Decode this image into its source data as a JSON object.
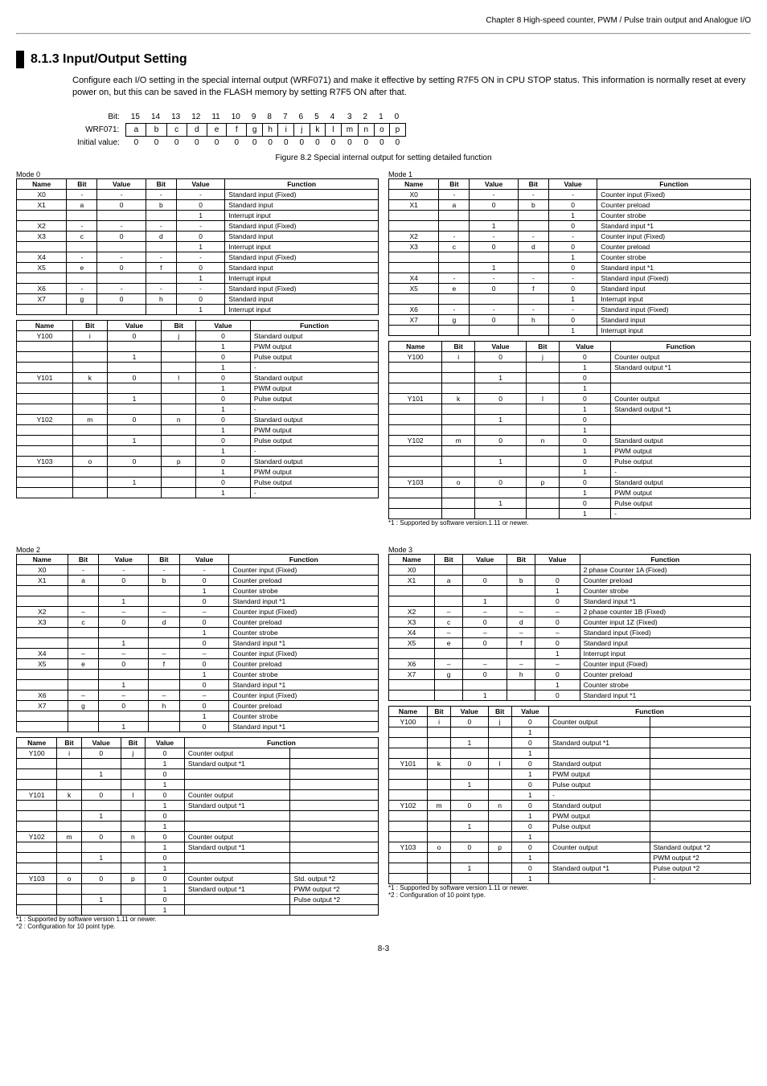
{
  "chapter": "Chapter 8  High-speed counter, PWM / Pulse train output and Analogue I/O",
  "section": "8.1.3    Input/Output Setting",
  "intro": "Configure each I/O setting in the special internal output (WRF071) and make it effective by setting R7F5 ON in CPU STOP status. This information is normally reset at every power on, but this can be saved in the FLASH memory by setting R7F5 ON after that.",
  "bit": {
    "label_bit": "Bit:",
    "label_wr": "WRF071:",
    "label_iv": "Initial value:",
    "cols": [
      "15",
      "14",
      "13",
      "12",
      "11",
      "10",
      "9",
      "8",
      "7",
      "6",
      "5",
      "4",
      "3",
      "2",
      "1",
      "0"
    ],
    "wr": [
      "a",
      "b",
      "c",
      "d",
      "e",
      "f",
      "g",
      "h",
      "i",
      "j",
      "k",
      "l",
      "m",
      "n",
      "o",
      "p"
    ],
    "iv": [
      "0",
      "0",
      "0",
      "0",
      "0",
      "0",
      "0",
      "0",
      "0",
      "0",
      "0",
      "0",
      "0",
      "0",
      "0",
      "0"
    ]
  },
  "caption": "Figure 8.2 Special internal output for setting detailed function",
  "heads": {
    "name": "Name",
    "bit": "Bit",
    "value": "Value",
    "bit2": "Bit",
    "value2": "Value",
    "fun": "Function"
  },
  "modes": {
    "m0": "Mode 0",
    "m1": "Mode 1",
    "m2": "Mode 2",
    "m3": "Mode 3"
  },
  "foot1": "*1 : Supported by software version.1.11 or newer.",
  "foot2_a": "*1 : Supported by software version 1.11 or newer.",
  "foot2_b": "*2 : Configuration for 10 point type.",
  "foot3_a": "*1 : Supported by software version 1.11 or newer.",
  "foot3_b": "*2 : Configuration of 10 point type.",
  "page": "8-3",
  "chart_data": [
    {
      "id": "m0a",
      "rows": [
        [
          "X0",
          "-",
          "-",
          "-",
          "-",
          "Standard input (Fixed)"
        ],
        [
          "X1",
          "a",
          "0",
          "b",
          "0",
          "Standard input"
        ],
        [
          "",
          "",
          "",
          "",
          "1",
          "Interrupt input"
        ],
        [
          "X2",
          "-",
          "-",
          "-",
          "-",
          "Standard input (Fixed)"
        ],
        [
          "X3",
          "c",
          "0",
          "d",
          "0",
          "Standard input"
        ],
        [
          "",
          "",
          "",
          "",
          "1",
          "Interrupt input"
        ],
        [
          "X4",
          "-",
          "-",
          "-",
          "-",
          "Standard input (Fixed)"
        ],
        [
          "X5",
          "e",
          "0",
          "f",
          "0",
          "Standard input"
        ],
        [
          "",
          "",
          "",
          "",
          "1",
          "Interrupt input"
        ],
        [
          "X6",
          "-",
          "-",
          "-",
          "-",
          "Standard input (Fixed)"
        ],
        [
          "X7",
          "g",
          "0",
          "h",
          "0",
          "Standard input"
        ],
        [
          "",
          "",
          "",
          "",
          "1",
          "Interrupt input"
        ]
      ]
    },
    {
      "id": "m0b",
      "rows": [
        [
          "Y100",
          "i",
          "0",
          "j",
          "0",
          "Standard output"
        ],
        [
          "",
          "",
          "",
          "",
          "1",
          "PWM output"
        ],
        [
          "",
          "",
          "1",
          "",
          "0",
          "Pulse output"
        ],
        [
          "",
          "",
          "",
          "",
          "1",
          "-"
        ],
        [
          "Y101",
          "k",
          "0",
          "l",
          "0",
          "Standard output"
        ],
        [
          "",
          "",
          "",
          "",
          "1",
          "PWM output"
        ],
        [
          "",
          "",
          "1",
          "",
          "0",
          "Pulse output"
        ],
        [
          "",
          "",
          "",
          "",
          "1",
          "-"
        ],
        [
          "Y102",
          "m",
          "0",
          "n",
          "0",
          "Standard output"
        ],
        [
          "",
          "",
          "",
          "",
          "1",
          "PWM output"
        ],
        [
          "",
          "",
          "1",
          "",
          "0",
          "Pulse output"
        ],
        [
          "",
          "",
          "",
          "",
          "1",
          "-"
        ],
        [
          "Y103",
          "o",
          "0",
          "p",
          "0",
          "Standard output"
        ],
        [
          "",
          "",
          "",
          "",
          "1",
          "PWM output"
        ],
        [
          "",
          "",
          "1",
          "",
          "0",
          "Pulse output"
        ],
        [
          "",
          "",
          "",
          "",
          "1",
          "-"
        ]
      ]
    },
    {
      "id": "m1a",
      "rows": [
        [
          "X0",
          "-",
          "-",
          "-",
          "-",
          "Counter input (Fixed)"
        ],
        [
          "X1",
          "a",
          "0",
          "b",
          "0",
          "Counter preload"
        ],
        [
          "",
          "",
          "",
          "",
          "1",
          "Counter strobe"
        ],
        [
          "",
          "",
          "1",
          "",
          "0",
          "Standard input *1"
        ],
        [
          "X2",
          "-",
          "-",
          "-",
          "-",
          "Counter input (Fixed)"
        ],
        [
          "X3",
          "c",
          "0",
          "d",
          "0",
          "Counter preload"
        ],
        [
          "",
          "",
          "",
          "",
          "1",
          "Counter strobe"
        ],
        [
          "",
          "",
          "1",
          "",
          "0",
          "Standard input *1"
        ],
        [
          "X4",
          "-",
          "-",
          "-",
          "-",
          "Standard input (Fixed)"
        ],
        [
          "X5",
          "e",
          "0",
          "f",
          "0",
          "Standard input"
        ],
        [
          "",
          "",
          "",
          "",
          "1",
          "Interrupt input"
        ],
        [
          "X6",
          "-",
          "-",
          "-",
          "-",
          "Standard input (Fixed)"
        ],
        [
          "X7",
          "g",
          "0",
          "h",
          "0",
          "Standard input"
        ],
        [
          "",
          "",
          "",
          "",
          "1",
          "Interrupt input"
        ]
      ]
    },
    {
      "id": "m1b",
      "rows": [
        [
          "Y100",
          "i",
          "0",
          "j",
          "0",
          "Counter output"
        ],
        [
          "",
          "",
          "",
          "",
          "1",
          "Standard output *1"
        ],
        [
          "",
          "",
          "1",
          "",
          "0",
          ""
        ],
        [
          "",
          "",
          "",
          "",
          "1",
          ""
        ],
        [
          "Y101",
          "k",
          "0",
          "l",
          "0",
          "Counter output"
        ],
        [
          "",
          "",
          "",
          "",
          "1",
          "Standard output *1"
        ],
        [
          "",
          "",
          "1",
          "",
          "0",
          ""
        ],
        [
          "",
          "",
          "",
          "",
          "1",
          ""
        ],
        [
          "Y102",
          "m",
          "0",
          "n",
          "0",
          "Standard output"
        ],
        [
          "",
          "",
          "",
          "",
          "1",
          "PWM output"
        ],
        [
          "",
          "",
          "1",
          "",
          "0",
          "Pulse output"
        ],
        [
          "",
          "",
          "",
          "",
          "1",
          "-"
        ],
        [
          "Y103",
          "o",
          "0",
          "p",
          "0",
          "Standard output"
        ],
        [
          "",
          "",
          "",
          "",
          "1",
          "PWM output"
        ],
        [
          "",
          "",
          "1",
          "",
          "0",
          "Pulse output"
        ],
        [
          "",
          "",
          "",
          "",
          "1",
          "-"
        ]
      ]
    },
    {
      "id": "m2a",
      "rows": [
        [
          "X0",
          "-",
          "-",
          "-",
          "-",
          "Counter input (Fixed)"
        ],
        [
          "X1",
          "a",
          "0",
          "b",
          "0",
          "Counter preload"
        ],
        [
          "",
          "",
          "",
          "",
          "1",
          "Counter strobe"
        ],
        [
          "",
          "",
          "1",
          "",
          "0",
          "Standard input *1"
        ],
        [
          "X2",
          "–",
          "–",
          "–",
          "–",
          "Counter input (Fixed)"
        ],
        [
          "X3",
          "c",
          "0",
          "d",
          "0",
          "Counter preload"
        ],
        [
          "",
          "",
          "",
          "",
          "1",
          "Counter strobe"
        ],
        [
          "",
          "",
          "1",
          "",
          "0",
          "Standard input *1"
        ],
        [
          "X4",
          "–",
          "–",
          "–",
          "–",
          "Counter input (Fixed)"
        ],
        [
          "X5",
          "e",
          "0",
          "f",
          "0",
          "Counter preload"
        ],
        [
          "",
          "",
          "",
          "",
          "1",
          "Counter strobe"
        ],
        [
          "",
          "",
          "1",
          "",
          "0",
          "Standard input *1"
        ],
        [
          "X6",
          "–",
          "–",
          "–",
          "–",
          "Counter input (Fixed)"
        ],
        [
          "X7",
          "g",
          "0",
          "h",
          "0",
          "Counter preload"
        ],
        [
          "",
          "",
          "",
          "",
          "1",
          "Counter strobe"
        ],
        [
          "",
          "",
          "1",
          "",
          "0",
          "Standard input *1"
        ]
      ]
    },
    {
      "id": "m2b",
      "rows": [
        [
          "Y100",
          "i",
          "0",
          "j",
          "0",
          "Counter output",
          ""
        ],
        [
          "",
          "",
          "",
          "",
          "1",
          "Standard output *1",
          ""
        ],
        [
          "",
          "",
          "1",
          "",
          "0",
          "",
          ""
        ],
        [
          "",
          "",
          "",
          "",
          "1",
          "",
          ""
        ],
        [
          "Y101",
          "k",
          "0",
          "l",
          "0",
          "Counter output",
          ""
        ],
        [
          "",
          "",
          "",
          "",
          "1",
          "Standard output *1",
          ""
        ],
        [
          "",
          "",
          "1",
          "",
          "0",
          "",
          ""
        ],
        [
          "",
          "",
          "",
          "",
          "1",
          "",
          ""
        ],
        [
          "Y102",
          "m",
          "0",
          "n",
          "0",
          "Counter output",
          ""
        ],
        [
          "",
          "",
          "",
          "",
          "1",
          "Standard output *1",
          ""
        ],
        [
          "",
          "",
          "1",
          "",
          "0",
          "",
          ""
        ],
        [
          "",
          "",
          "",
          "",
          "1",
          "",
          ""
        ],
        [
          "Y103",
          "o",
          "0",
          "p",
          "0",
          "Counter output",
          "Std. output *2"
        ],
        [
          "",
          "",
          "",
          "",
          "1",
          "Standard output *1",
          "PWM output *2"
        ],
        [
          "",
          "",
          "1",
          "",
          "0",
          "",
          "Pulse output *2"
        ],
        [
          "",
          "",
          "",
          "",
          "1",
          "",
          ""
        ]
      ]
    },
    {
      "id": "m3a",
      "rows": [
        [
          "X0",
          "",
          "",
          "",
          "",
          "2 phase Counter 1A (Fixed)"
        ],
        [
          "X1",
          "a",
          "0",
          "b",
          "0",
          "Counter preload"
        ],
        [
          "",
          "",
          "",
          "",
          "1",
          "Counter strobe"
        ],
        [
          "",
          "",
          "1",
          "",
          "0",
          "Standard input *1"
        ],
        [
          "X2",
          "–",
          "–",
          "–",
          "–",
          "2 phase counter 1B (Fixed)"
        ],
        [
          "X3",
          "c",
          "0",
          "d",
          "0",
          "Counter input 1Z (Fixed)"
        ],
        [
          "X4",
          "–",
          "–",
          "–",
          "–",
          "Standard input (Fixed)"
        ],
        [
          "X5",
          "e",
          "0",
          "f",
          "0",
          "Standard input"
        ],
        [
          "",
          "",
          "",
          "",
          "1",
          "Interrupt input"
        ],
        [
          "X6",
          "–",
          "–",
          "–",
          "–",
          "Counter input (Fixed)"
        ],
        [
          "X7",
          "g",
          "0",
          "h",
          "0",
          "Counter preload"
        ],
        [
          "",
          "",
          "",
          "",
          "1",
          "Counter strobe"
        ],
        [
          "",
          "",
          "1",
          "",
          "0",
          "Standard input *1"
        ]
      ]
    },
    {
      "id": "m3b",
      "rows": [
        [
          "Y100",
          "i",
          "0",
          "j",
          "0",
          "Counter output",
          ""
        ],
        [
          "",
          "",
          "",
          "",
          "1",
          "",
          ""
        ],
        [
          "",
          "",
          "1",
          "",
          "0",
          "Standard output *1",
          ""
        ],
        [
          "",
          "",
          "",
          "",
          "1",
          "",
          ""
        ],
        [
          "Y101",
          "k",
          "0",
          "l",
          "0",
          "Standard output",
          ""
        ],
        [
          "",
          "",
          "",
          "",
          "1",
          "PWM output",
          ""
        ],
        [
          "",
          "",
          "1",
          "",
          "0",
          "Pulse output",
          ""
        ],
        [
          "",
          "",
          "",
          "",
          "1",
          "-",
          ""
        ],
        [
          "Y102",
          "m",
          "0",
          "n",
          "0",
          "Standard output",
          ""
        ],
        [
          "",
          "",
          "",
          "",
          "1",
          "PWM output",
          ""
        ],
        [
          "",
          "",
          "1",
          "",
          "0",
          "Pulse output",
          ""
        ],
        [
          "",
          "",
          "",
          "",
          "1",
          "",
          ""
        ],
        [
          "Y103",
          "o",
          "0",
          "p",
          "0",
          "Counter output",
          "Standard output *2"
        ],
        [
          "",
          "",
          "",
          "",
          "1",
          "",
          "PWM output *2"
        ],
        [
          "",
          "",
          "1",
          "",
          "0",
          "Standard output *1",
          "Pulse output *2"
        ],
        [
          "",
          "",
          "",
          "",
          "1",
          "",
          "-"
        ]
      ]
    }
  ]
}
